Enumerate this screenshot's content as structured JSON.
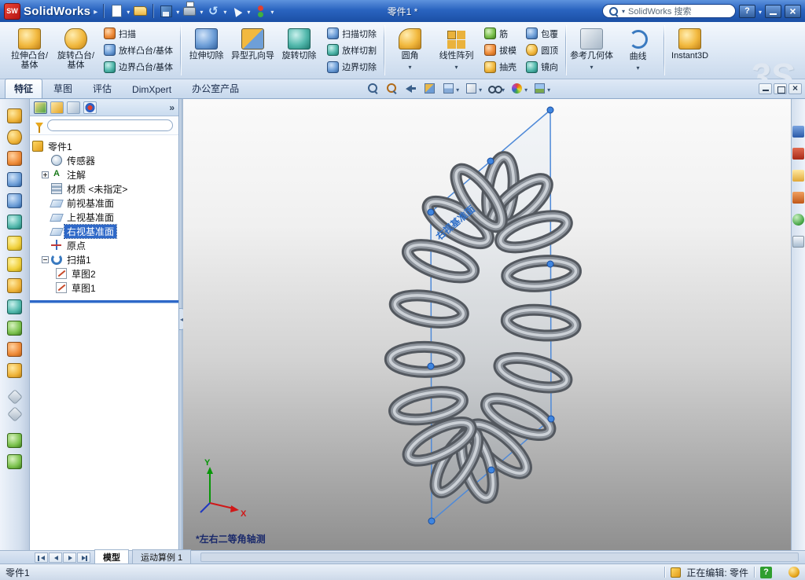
{
  "colors": {
    "titlebar_blue": "#2a64c0",
    "selection_blue": "#2e68c8",
    "plane_blue": "#4f8ad8",
    "spring_gray": "#8d939b",
    "viewport_gradient_top": "#fafafa",
    "viewport_gradient_bottom": "#8f8f8f",
    "status_help_green": "#2f9e2f"
  },
  "titlebar": {
    "logo": "SW",
    "app": "SolidWorks",
    "doc": "零件1 *",
    "search": "SolidWorks 搜索",
    "help": "?"
  },
  "ribbon": {
    "items": [
      {
        "label": "拉伸凸台/基体"
      },
      {
        "label": "旋转凸台/基体"
      },
      {
        "label": "扫描"
      },
      {
        "label": "放样凸台/基体"
      },
      {
        "label": "边界凸台/基体"
      },
      {
        "label": "拉伸切除"
      },
      {
        "label": "异型孔向导"
      },
      {
        "label": "旋转切除"
      },
      {
        "label": "扫描切除"
      },
      {
        "label": "放样切割"
      },
      {
        "label": "边界切除"
      },
      {
        "label": "圆角"
      },
      {
        "label": "线性阵列"
      },
      {
        "label": "筋"
      },
      {
        "label": "拔模"
      },
      {
        "label": "抽壳"
      },
      {
        "label": "包覆"
      },
      {
        "label": "圆顶"
      },
      {
        "label": "镜向"
      },
      {
        "label": "参考几何体"
      },
      {
        "label": "曲线"
      },
      {
        "label": "Instant3D"
      }
    ],
    "watermark": "3S"
  },
  "tabs": {
    "items": [
      "特征",
      "草图",
      "评估",
      "DimXpert",
      "办公室产品"
    ]
  },
  "feature_tree": {
    "root": "零件1",
    "items": [
      "传感器",
      "注解",
      "材质 <未指定>",
      "前视基准面",
      "上视基准面",
      "右视基准面",
      "原点",
      "扫描1",
      "草图2",
      "草图1"
    ]
  },
  "viewport": {
    "plane_label": "右视基准面",
    "view_annotation": "*左右二等角轴测",
    "axis_x": "X",
    "axis_y": "Y"
  },
  "bottom_bar": {
    "tabs": [
      "模型",
      "运动算例 1"
    ]
  },
  "statusbar": {
    "document": "零件1",
    "editing": "正在编辑: 零件",
    "help": "?"
  }
}
